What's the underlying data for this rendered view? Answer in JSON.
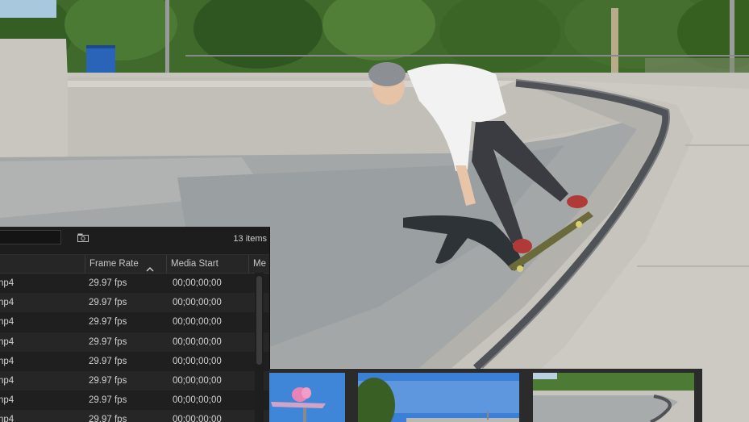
{
  "project_panel": {
    "search": {
      "value": "",
      "placeholder": ""
    },
    "item_count": "13 items",
    "columns": [
      {
        "label": ""
      },
      {
        "label": "Frame Rate"
      },
      {
        "label": "Media Start"
      },
      {
        "label": "Me"
      }
    ],
    "rows": [
      {
        "name": "np4",
        "frame_rate": "29.97 fps",
        "media_start": "00;00;00;00"
      },
      {
        "name": "np4",
        "frame_rate": "29.97 fps",
        "media_start": "00;00;00;00"
      },
      {
        "name": "np4",
        "frame_rate": "29.97 fps",
        "media_start": "00;00;00;00"
      },
      {
        "name": "np4",
        "frame_rate": "29.97 fps",
        "media_start": "00;00;00;00"
      },
      {
        "name": "np4",
        "frame_rate": "29.97 fps",
        "media_start": "00;00;00;00"
      },
      {
        "name": "np4",
        "frame_rate": "29.97 fps",
        "media_start": "00;00;00;00"
      },
      {
        "name": "np4",
        "frame_rate": "29.97 fps",
        "media_start": "00;00;00;00"
      },
      {
        "name": "np4",
        "frame_rate": "29.97 fps",
        "media_start": "00;00;00;00"
      }
    ]
  },
  "icons": {
    "bin": "new-bin-icon",
    "sort": "sort-ascending-icon"
  },
  "colors": {
    "panel_bg": "#232323",
    "row_odd": "#1f1f1f",
    "row_even": "#262626",
    "text": "#d2d2d2"
  }
}
